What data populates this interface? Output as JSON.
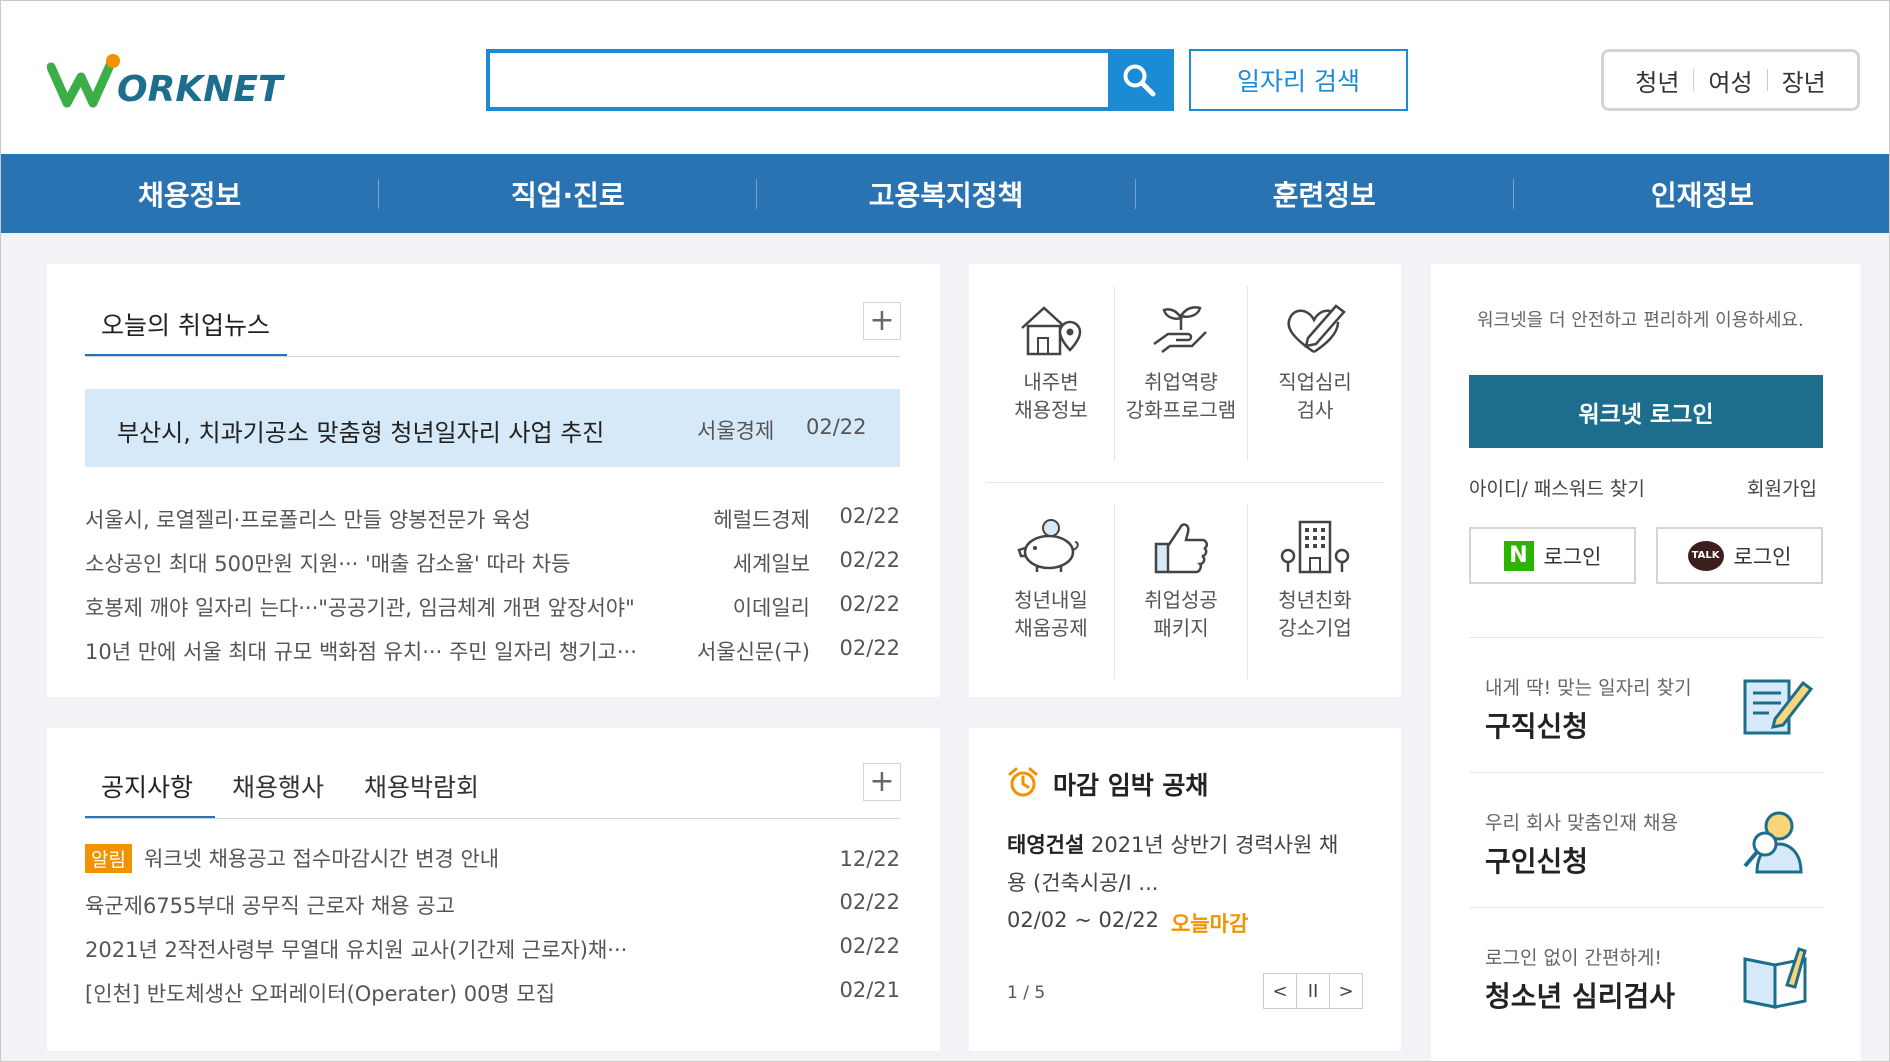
{
  "header": {
    "logo_text": "WORKNET",
    "search": {
      "value": "",
      "placeholder": ""
    },
    "job_search_label": "일자리 검색",
    "targets": [
      "청년",
      "여성",
      "장년"
    ]
  },
  "gnb": [
    "채용정보",
    "직업·진로",
    "고용복지정책",
    "훈련정보",
    "인재정보"
  ],
  "news": {
    "title": "오늘의 취업뉴스",
    "highlight": {
      "title": "부산시, 치과기공소 맞춤형 청년일자리 사업 추진",
      "source": "서울경제",
      "date": "02/22"
    },
    "items": [
      {
        "title": "서울시, 로열젤리·프로폴리스 만들 양봉전문가 육성",
        "source": "헤럴드경제",
        "date": "02/22"
      },
      {
        "title": "소상공인 최대 500만원 지원··· '매출 감소율' 따라 차등",
        "source": "세계일보",
        "date": "02/22"
      },
      {
        "title": "호봉제 깨야 일자리 는다···\"공공기관, 임금체계 개편 앞장서야\"",
        "source": "이데일리",
        "date": "02/22"
      },
      {
        "title": "10년 만에 서울 최대 규모 백화점 유치··· 주민 일자리 챙기고···",
        "source": "서울신문(구)",
        "date": "02/22"
      }
    ]
  },
  "quick_menu": [
    {
      "l1": "내주변",
      "l2": "채용정보",
      "icon": "house-location-icon"
    },
    {
      "l1": "취업역량",
      "l2": "강화프로그램",
      "icon": "sprout-hand-icon"
    },
    {
      "l1": "직업심리",
      "l2": "검사",
      "icon": "heart-pencil-icon"
    },
    {
      "l1": "청년내일",
      "l2": "채움공제",
      "icon": "piggy-bank-icon"
    },
    {
      "l1": "취업성공",
      "l2": "패키지",
      "icon": "thumbs-up-icon"
    },
    {
      "l1": "청년친화",
      "l2": "강소기업",
      "icon": "building-icon"
    }
  ],
  "login": {
    "notice": "워크넷을 더 안전하고 편리하게 이용하세요.",
    "login_button": "워크넷 로그인",
    "find_id": "아이디/ 패스워드 찾기",
    "join": "회원가입",
    "naver_letter": "N",
    "naver_login": "로그인",
    "kakao_talk": "TALK",
    "kakao_login": "로그인"
  },
  "notices": {
    "tabs": [
      "공지사항",
      "채용행사",
      "채용박람회"
    ],
    "badge": "알림",
    "items": [
      {
        "title": "워크넷 채용공고 접수마감시간 변경 안내",
        "date": "12/22"
      },
      {
        "title": "육군제6755부대 공무직 근로자 채용 공고",
        "date": "02/22"
      },
      {
        "title": "2021년 2작전사령부 무열대 유치원 교사(기간제 근로자)채···",
        "date": "02/22"
      },
      {
        "title": "[인천] 반도체생산 오퍼레이터(Operater) 00명 모집",
        "date": "02/21"
      }
    ]
  },
  "deadline": {
    "title": "마감 임박 공채",
    "company": "태영건설",
    "desc_line1": "2021년 상반기 경력사원 채",
    "desc_line2": "용 (건축시공/I ...",
    "period": "02/02 ~ 02/22",
    "status": "오늘마감",
    "pager": "1 / 5",
    "prev": "<",
    "pause": "II",
    "next": ">"
  },
  "services": [
    {
      "sub": "내게 딱! 맞는 일자리 찾기",
      "title": "구직신청",
      "icon": "resume-pen-icon"
    },
    {
      "sub": "우리 회사 맞춤인재 채용",
      "title": "구인신청",
      "icon": "person-magnifier-icon"
    },
    {
      "sub": "로그인 없이 간편하게!",
      "title": "청소년 심리검사",
      "icon": "book-pencil-icon"
    }
  ],
  "colors": {
    "primary": "#2a73b3",
    "accent_blue": "#1b8bd5",
    "login_teal": "#1d6e8c",
    "orange": "#f39200",
    "highlight_bg": "#d6e9f8",
    "naver_green": "#2db400"
  }
}
